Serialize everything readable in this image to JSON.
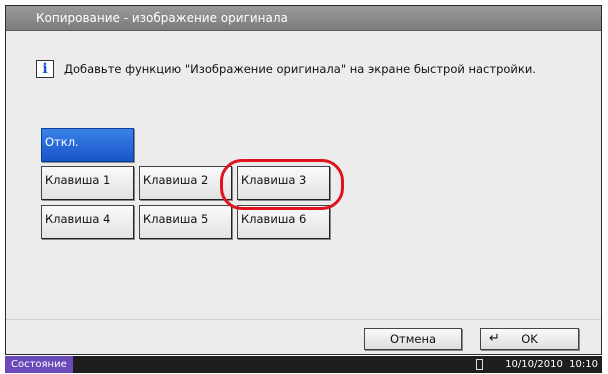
{
  "window": {
    "title": "Копирование - изображение оригинала"
  },
  "info": {
    "icon": "info-icon",
    "message": "Добавьте функцию \"Изображение оригинала\" на экране быстрой настройки."
  },
  "keys": {
    "off": "Откл.",
    "k1": "Клавиша 1",
    "k2": "Клавиша 2",
    "k3": "Клавиша 3",
    "k4": "Клавиша 4",
    "k5": "Клавиша 5",
    "k6": "Клавиша 6",
    "selected": "off"
  },
  "footer": {
    "cancel": "Отмена",
    "ok": "OK"
  },
  "status": {
    "label": "Состояние",
    "datetime": "10/10/2010  10:10"
  },
  "colors": {
    "selected_key": "#1a55c8",
    "highlight_ring": "#e0121f",
    "status_label": "#6a4ab8"
  }
}
